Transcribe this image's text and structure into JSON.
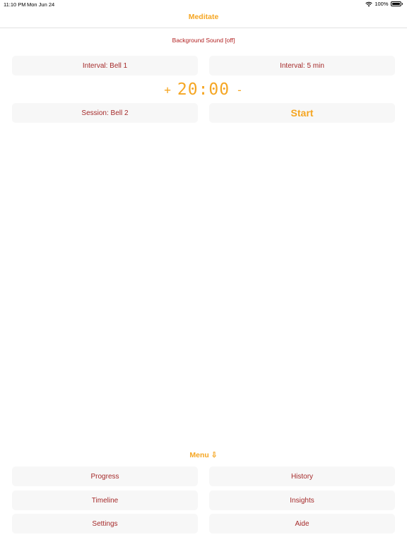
{
  "status_bar": {
    "time": "11:10 PM",
    "date": "Mon Jun 24",
    "battery": "100%"
  },
  "nav": {
    "title": "Meditate"
  },
  "background_sound": "Background Sound [off]",
  "controls": {
    "interval_bell": "Interval: Bell 1",
    "interval_time": "Interval: 5 min",
    "timer_plus": "+",
    "timer_value": "20:00",
    "timer_minus": "-",
    "session_bell": "Session: Bell 2",
    "start": "Start"
  },
  "menu": {
    "header": "Menu ⇩",
    "items": [
      "Progress",
      "History",
      "Timeline",
      "Insights",
      "Settings",
      "Aide"
    ]
  },
  "colors": {
    "accent": "#f5a623",
    "text_red": "#a52a2a",
    "button_bg": "#f7f7f7"
  }
}
